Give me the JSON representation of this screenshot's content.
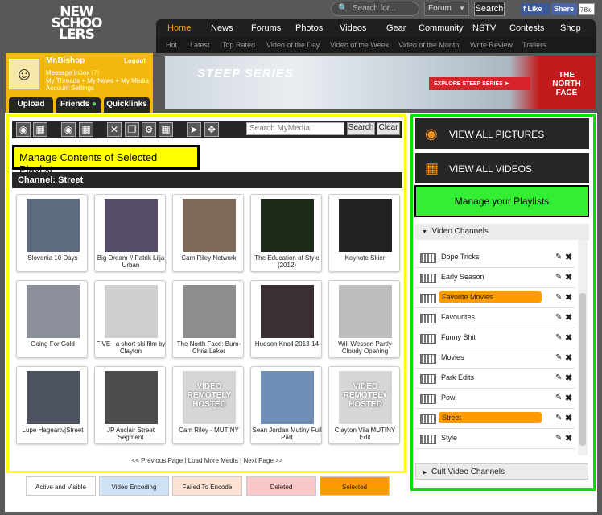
{
  "header": {
    "logo": "NEW SCHOOLERS",
    "search_placeholder": "Search for...",
    "forum_select": "Forum",
    "search_button": "Search",
    "fb_like": "Like",
    "share": "Share",
    "like_count": "78k"
  },
  "nav": {
    "items": [
      "Home",
      "News",
      "Forums",
      "Photos",
      "Videos",
      "Gear",
      "Community",
      "NSTV",
      "Contests",
      "Shop"
    ],
    "active": "Home"
  },
  "subnav": {
    "items": [
      "Hot",
      "Latest",
      "Top Rated",
      "Video of the Day",
      "Video of the Week",
      "Video of the Month",
      "Write Review",
      "Trailers"
    ]
  },
  "banner": {
    "title": "STEEP SERIES",
    "cta": "EXPLORE STEEP SERIES",
    "brand": "THE NORTH FACE"
  },
  "user": {
    "name": "Mr.Bishop",
    "logout": "Logout",
    "inbox_label": "Message Inbox",
    "inbox_count": "(7)",
    "links": "My Threads + My News + My Media",
    "settings": "Account Settings",
    "buttons": [
      "Upload",
      "Friends",
      "Quicklinks"
    ]
  },
  "toolbar": {
    "search_placeholder": "Search MyMedia",
    "search_button": "Search",
    "clear_button": "Clear"
  },
  "manage_title": "Manage Contents of Selected Playlist",
  "channel_label": "Channel: Street",
  "media": [
    {
      "title": "Slovenia 10 Days",
      "thumb": "#5d6c7d"
    },
    {
      "title": "Big Dream // Patrik Lilja Urban",
      "thumb": "#574d6b"
    },
    {
      "title": "Cam Riley|Network",
      "thumb": "#7e6b58"
    },
    {
      "title": "The Education of Style (2012)",
      "thumb": "#1e2a1a"
    },
    {
      "title": "Keynote Skier",
      "thumb": "#222222"
    },
    {
      "title": "Going For Gold",
      "thumb": "#8a8f99"
    },
    {
      "title": "FIVE | a short ski film by Clayton",
      "thumb": "#cfcfcf"
    },
    {
      "title": "The North Face: Burn- Chris Laker",
      "thumb": "#8d8d8d"
    },
    {
      "title": "Hudson Knoll 2013-14",
      "thumb": "#3a3034"
    },
    {
      "title": "Will Wesson Partly Cloudy Opening",
      "thumb": "#bdbdbd"
    },
    {
      "title": "Lupe Hageartv|Street",
      "thumb": "#4c5260"
    },
    {
      "title": "JP Auclair Street Segment",
      "thumb": "#4d4d4d"
    },
    {
      "title": "Cam Riley - MUTINY",
      "thumb": "#d6d6d6",
      "placeholder": "VIDEO REMOTELY HOSTED"
    },
    {
      "title": "Sean Jordan Mutiny Full Part",
      "thumb": "#6f8fb7"
    },
    {
      "title": "Clayton Vila MUTINY Edit",
      "thumb": "#d6d6d6",
      "placeholder": "VIDEO REMOTELY HOSTED"
    }
  ],
  "pager": "<< Previous Page | Load More Media | Next Page >>",
  "legend": [
    {
      "label": "Active and Visible",
      "color": "#ffffff"
    },
    {
      "label": "Video Encoding",
      "color": "#cfe2f6"
    },
    {
      "label": "Failed To Encode",
      "color": "#fbe2d2"
    },
    {
      "label": "Deleted",
      "color": "#f8c7c7"
    },
    {
      "label": "Selected",
      "color": "#ff9b00"
    }
  ],
  "right": {
    "view_pictures": "VIEW ALL PICTURES",
    "view_videos": "VIEW ALL VIDEOS",
    "manage_playlists": "Manage your Playlists",
    "video_channels": "Video Channels",
    "cult_channels": "Cult Video Channels",
    "playlists": [
      {
        "name": "Dope Tricks",
        "selected": false
      },
      {
        "name": "Early Season",
        "selected": false
      },
      {
        "name": "Favorite Movies",
        "selected": true
      },
      {
        "name": "Favourites",
        "selected": false
      },
      {
        "name": "Funny Shit",
        "selected": false
      },
      {
        "name": "Movies",
        "selected": false
      },
      {
        "name": "Park Edits",
        "selected": false
      },
      {
        "name": "Pow",
        "selected": false
      },
      {
        "name": "Street",
        "selected": true
      },
      {
        "name": "Style",
        "selected": false
      }
    ]
  }
}
